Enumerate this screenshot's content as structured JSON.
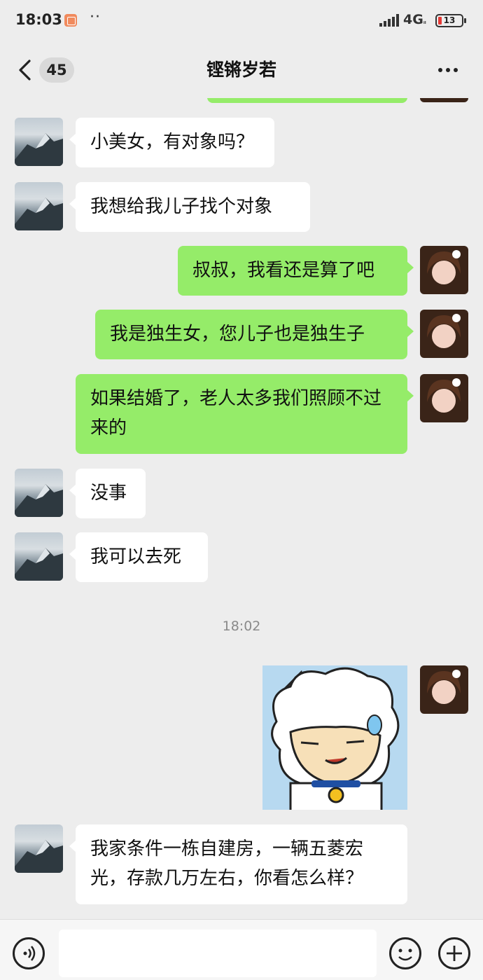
{
  "status_bar": {
    "time": "18:03",
    "network": "4G",
    "network_sub": "ᵢₗ",
    "battery": "13"
  },
  "header": {
    "unread_count": "45",
    "title": "铿锵岁若"
  },
  "messages": [
    {
      "side": "left",
      "text": "小美女，有对象吗？"
    },
    {
      "side": "left",
      "text": "我想给我儿子找个对象"
    },
    {
      "side": "right",
      "text": "叔叔，我看还是算了吧"
    },
    {
      "side": "right",
      "text": "我是独生女，您儿子也是独生子"
    },
    {
      "side": "right",
      "text": "如果结婚了，老人太多我们照顾不过来的"
    },
    {
      "side": "left",
      "text": "没事"
    },
    {
      "side": "left",
      "text": "我可以去死"
    },
    {
      "side": "left",
      "text": "我家条件一栋自建房，一辆五菱宏光，存款几万左右，你看怎么样？"
    }
  ],
  "timestamp": "18:02",
  "icons": {
    "back": "chevron-left-icon",
    "more": "more-dots-icon",
    "voice": "voice-icon",
    "emoji": "emoji-icon",
    "plus": "plus-icon"
  },
  "colors": {
    "background": "#ededed",
    "bubble_self": "#95ec69",
    "bubble_other": "#ffffff"
  }
}
